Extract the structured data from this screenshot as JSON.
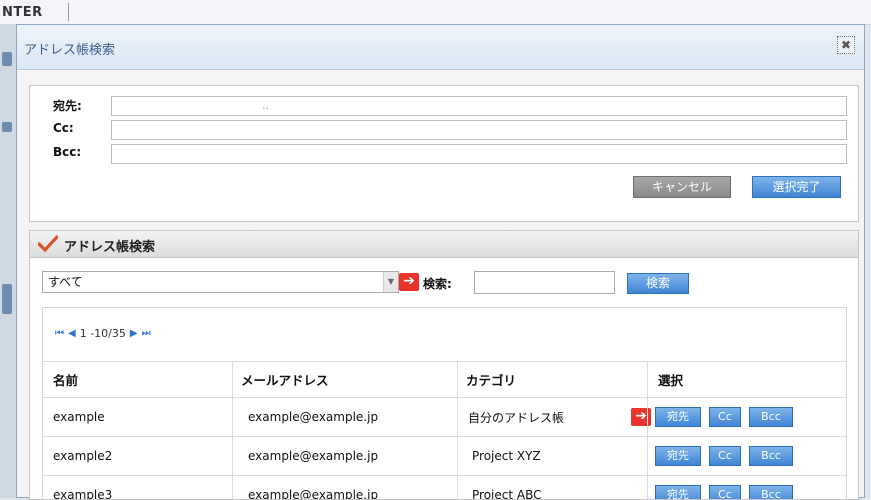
{
  "background": {
    "title": "NTER"
  },
  "dialog": {
    "title": "アドレス帳検索"
  },
  "recipients": {
    "to_label": "宛先:",
    "cc_label": "Cc:",
    "bcc_label": "Bcc:",
    "to_value": "..",
    "cc_value": "",
    "bcc_value": "",
    "cancel_label": "キャンセル",
    "done_label": "選択完了"
  },
  "search": {
    "title": "アドレス帳検索",
    "category_selected": "すべて",
    "search_label": "検索:",
    "search_value": "",
    "search_button": "検索"
  },
  "pager": {
    "range": "1 -10/35"
  },
  "table": {
    "headers": {
      "name": "名前",
      "email": "メールアドレス",
      "category": "カテゴリ",
      "select": "選択"
    },
    "rows": [
      {
        "name": "example",
        "email": "example@example.jp",
        "category": "自分のアドレス帳"
      },
      {
        "name": "example2",
        "email": "example@example.jp",
        "category": "Project XYZ"
      },
      {
        "name": "example3",
        "email": "example@example.jp",
        "category": "Project ABC"
      }
    ],
    "to_button": "宛先",
    "cc_button": "Cc",
    "bcc_button": "Bcc"
  }
}
